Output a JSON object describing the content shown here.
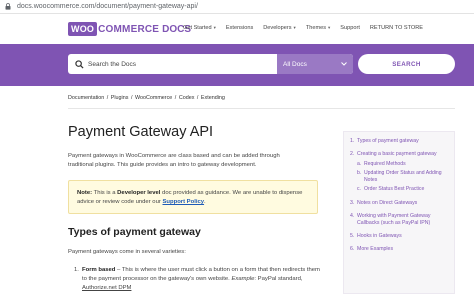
{
  "browser": {
    "url": "docs.woocommerce.com/document/payment-gateway-api/"
  },
  "header": {
    "logo": {
      "woo": "WOO",
      "commerce": "COMMERCE",
      "docs": "DOCS"
    },
    "menu": [
      {
        "label": "Get Started",
        "has_caret": true
      },
      {
        "label": "Extensions",
        "has_caret": false
      },
      {
        "label": "Developers",
        "has_caret": true
      },
      {
        "label": "Themes",
        "has_caret": true
      },
      {
        "label": "Support",
        "has_caret": false
      },
      {
        "label": "RETURN TO STORE",
        "has_caret": false
      }
    ]
  },
  "search": {
    "placeholder": "Search the Docs",
    "scope": "All Docs",
    "button": "SEARCH"
  },
  "breadcrumb": [
    "Documentation",
    "Plugins",
    "WooCommerce",
    "Codex",
    "Extending"
  ],
  "article": {
    "title": "Payment Gateway API",
    "intro": "Payment gateways in WooCommerce are class based and can be added through traditional plugins. This guide provides an intro to gateway development.",
    "note": {
      "label": "Note:",
      "text_1": " This is a ",
      "emphasis": "Developer level",
      "text_2": " doc provided as guidance. We are unable to dispense advice or review code under our ",
      "link": "Support Policy",
      "text_3": "."
    },
    "section_title": "Types of payment gateway",
    "section_intro": "Payment gateways come in several varieties:",
    "list": [
      {
        "num": "1.",
        "bold": "Form based",
        "text": " – This is where the user must click a button on a form that then redirects them to the payment processor on the gateway's own website. ",
        "example_label": "Example",
        "example_text": ": PayPal standard, ",
        "example_link": "Authorize.net DPM"
      }
    ]
  },
  "toc": {
    "items": [
      {
        "num": "1.",
        "label": "Types of payment gateway"
      },
      {
        "num": "2.",
        "label": "Creating a basic payment gateway",
        "subs": [
          {
            "num": "a.",
            "label": "Required Methods"
          },
          {
            "num": "b.",
            "label": "Updating Order Status and Adding Notes"
          },
          {
            "num": "c.",
            "label": "Order Status Best Practice"
          }
        ]
      },
      {
        "num": "3.",
        "label": "Notes on Direct Gateways"
      },
      {
        "num": "4.",
        "label": "Working with Payment Gateway Callbacks (such as PayPal IPN)"
      },
      {
        "num": "5.",
        "label": "Hooks in Gateways"
      },
      {
        "num": "6.",
        "label": "More Examples"
      }
    ]
  },
  "colors": {
    "brand": "#7f54b3",
    "note_bg": "#fffbe0",
    "link": "#1e5bb8"
  }
}
